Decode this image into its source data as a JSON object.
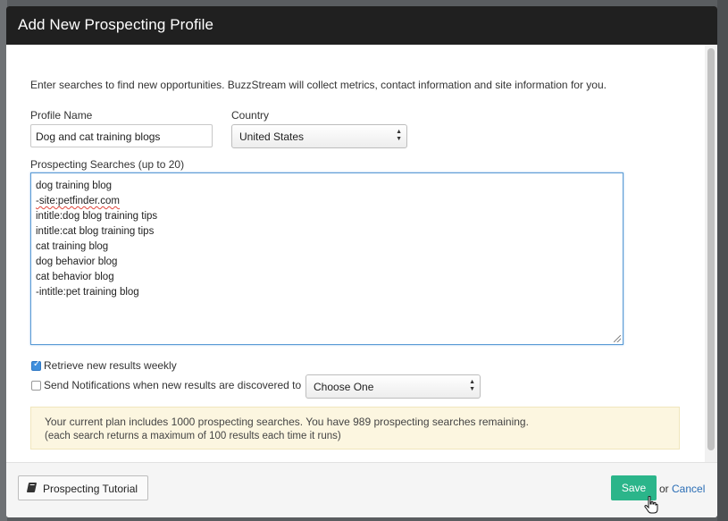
{
  "dialog": {
    "title": "Add New Prospecting Profile",
    "intro": "Enter searches to find new opportunities. BuzzStream will collect metrics, contact information and site information for you."
  },
  "profile_name": {
    "label": "Profile Name",
    "value": "Dog and cat training blogs"
  },
  "country": {
    "label": "Country",
    "value": "United States"
  },
  "searches": {
    "label": "Prospecting Searches (up to 20)",
    "lines": [
      "dog training blog",
      "-site:petfinder.com",
      "intitle:dog blog training tips",
      "intitle:cat blog training tips",
      "cat training blog",
      "dog behavior blog",
      "cat behavior blog",
      "-intitle:pet training blog"
    ]
  },
  "options": {
    "weekly_label": "Retrieve new results weekly",
    "weekly_checked": true,
    "notify_label": "Send Notifications when new results are discovered to",
    "notify_checked": false,
    "notify_select": "Choose One"
  },
  "notice": {
    "line1": "Your current plan includes 1000 prospecting searches. You have 989 prospecting searches remaining.",
    "line2": "(each search returns a maximum of 100 results each time it runs)"
  },
  "footer": {
    "tutorial_label": "Prospecting Tutorial",
    "save_label": "Save",
    "or_text": "or",
    "cancel_label": "Cancel"
  },
  "colors": {
    "header_bg": "#202020",
    "save_button": "#2bb58a",
    "link": "#2a6db5",
    "notice_bg": "#fcf6e0",
    "checkbox_on": "#3f8fdd"
  }
}
